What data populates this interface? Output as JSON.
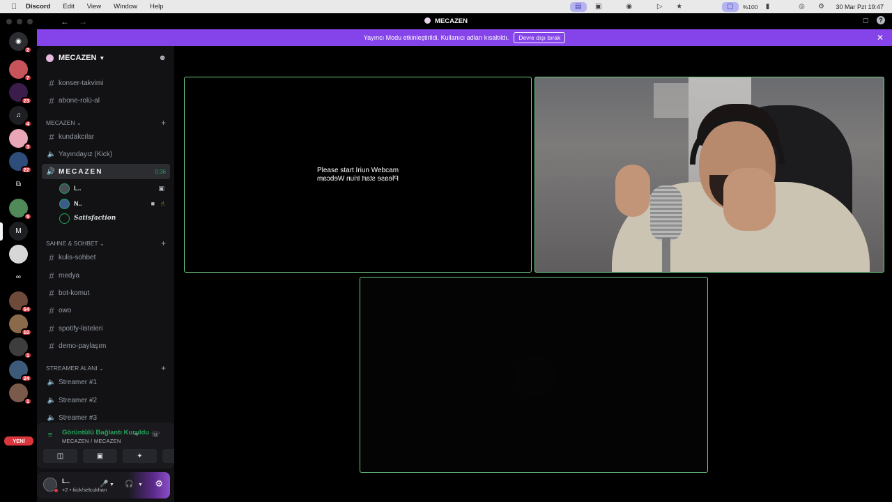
{
  "menubar": {
    "app": "Discord",
    "items": [
      "Edit",
      "View",
      "Window",
      "Help"
    ],
    "battery": "%100",
    "datetime": "30 Mar Pzt  19:47"
  },
  "window": {
    "title": "MECAZEN"
  },
  "rail": {
    "servers": [
      {
        "badge": "2",
        "color": "#2b2d31",
        "glyph": "◉"
      },
      {
        "badge": "7",
        "color": "#c7545b",
        "glyph": ""
      },
      {
        "badge": "23",
        "color": "#3a1d4a",
        "glyph": ""
      },
      {
        "badge": "4",
        "color": "#1e1f22",
        "glyph": "♫"
      },
      {
        "badge": "3",
        "color": "#e8a6b6",
        "glyph": ""
      },
      {
        "badge": "22",
        "color": "#2f4d7a",
        "glyph": ""
      },
      {
        "badge": "",
        "color": "#000000",
        "glyph": "⧉"
      },
      {
        "badge": "5",
        "color": "#4f8a58",
        "glyph": ""
      },
      {
        "badge": "",
        "color": "#1e1f22",
        "glyph": "M"
      },
      {
        "badge": "",
        "color": "#d7d7d7",
        "glyph": ""
      },
      {
        "badge": "",
        "color": "#000000",
        "glyph": "∞"
      },
      {
        "badge": "54",
        "color": "#6e4a3a",
        "glyph": ""
      },
      {
        "badge": "10",
        "color": "#8a6a4a",
        "glyph": ""
      },
      {
        "badge": "1",
        "color": "#3d3d3d",
        "glyph": ""
      },
      {
        "badge": "24",
        "color": "#3c5a7a",
        "glyph": ""
      },
      {
        "badge": "1",
        "color": "#7a5a4a",
        "glyph": ""
      }
    ],
    "new_label": "YENİ"
  },
  "banner": {
    "text": "Yayıncı Modu etkinleştirildi. Kullanıcı adları kısaltıldı.",
    "button": "Devre dışı bırak"
  },
  "sidebar": {
    "server_name": "MECAZEN",
    "channels_top": [
      "konser-takvimi",
      "abone-rolü-al"
    ],
    "cat_mecazen": "MECAZEN",
    "mecazen_channels": [
      "kundakcılar",
      "Yayındayız (Kick)"
    ],
    "active_voice": {
      "name": "MECAZEN",
      "timer": "0:36"
    },
    "voice_users": [
      "L..",
      "N..",
      "Satisfaction"
    ],
    "cat_sahne": "SAHNE & SOHBET",
    "sahne_channels": [
      "kulis-sohbet",
      "medya",
      "bot-komut",
      "owo",
      "spotify-listeleri",
      "demo-paylaşım"
    ],
    "cat_streamer": "STREAMER ALANI",
    "streamer_channels": [
      "Streamer #1",
      "Streamer #2",
      "Streamer #3"
    ]
  },
  "voice_panel": {
    "title": "Görüntülü Bağlantı Kuruldu",
    "subtitle": "MECAZEN / MECAZEN"
  },
  "user_panel": {
    "name": "L..",
    "status": "+2 • kick/selcukhan"
  },
  "video": {
    "placeholder_line": "Please start Iriun Webcam"
  }
}
